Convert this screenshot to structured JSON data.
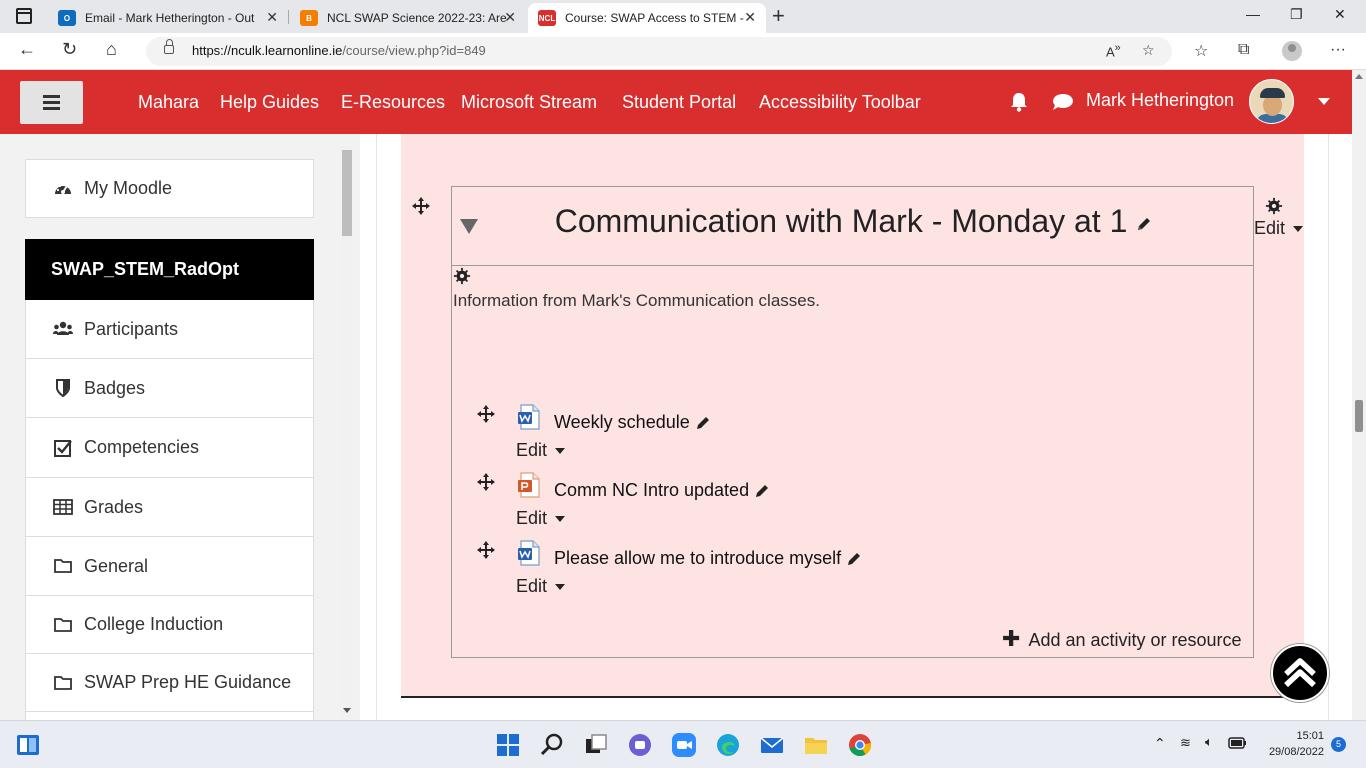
{
  "browser": {
    "tabs": [
      {
        "title": "Email - Mark Hetherington - Out",
        "favicon": "outlook-icon",
        "favicon_color": "#0f6cbd"
      },
      {
        "title": "NCL SWAP Science 2022-23: Are",
        "favicon": "blogger-icon",
        "favicon_color": "#f57d00"
      },
      {
        "title": "Course: SWAP Access to STEM -",
        "favicon": "ncl-icon",
        "favicon_color": "#d92e2e",
        "favicon_text": "NCL"
      }
    ],
    "url_host": "https://nculk.learnonline.ie",
    "url_path": "/course/view.php?id=849"
  },
  "header": {
    "nav_links": [
      "Mahara",
      "Help Guides",
      "E-Resources",
      "Microsoft Stream",
      "Student Portal",
      "Accessibility Toolbar"
    ],
    "user_name": "Mark Hetherington",
    "brand_color": "#d92e2e"
  },
  "sidebar": {
    "items": [
      {
        "label": "My Moodle",
        "icon": "dashboard-icon"
      },
      {
        "label": "SWAP_STEM_RadOpt",
        "icon": ""
      },
      {
        "label": "Participants",
        "icon": "users-icon"
      },
      {
        "label": "Badges",
        "icon": "shield-icon"
      },
      {
        "label": "Competencies",
        "icon": "checkbox-icon"
      },
      {
        "label": "Grades",
        "icon": "table-icon"
      },
      {
        "label": "General",
        "icon": "folder-icon"
      },
      {
        "label": "College Induction",
        "icon": "folder-icon"
      },
      {
        "label": "SWAP Prep HE Guidance",
        "icon": "folder-icon"
      }
    ]
  },
  "section": {
    "title": "Communication with Mark - Monday at 1",
    "summary": "Information from Mark's Communication classes.",
    "edit_label": "Edit",
    "activities": [
      {
        "name": "Weekly schedule",
        "type": "word",
        "edit_label": "Edit"
      },
      {
        "name": "Comm NC Intro updated",
        "type": "powerpoint",
        "edit_label": "Edit"
      },
      {
        "name": "Please allow me to introduce myself",
        "type": "word",
        "edit_label": "Edit"
      }
    ],
    "add_activity_label": "Add an activity or resource",
    "panel_color": "#fde4e2"
  },
  "taskbar": {
    "time": "15:01",
    "date": "29/08/2022",
    "notifications": "5"
  }
}
